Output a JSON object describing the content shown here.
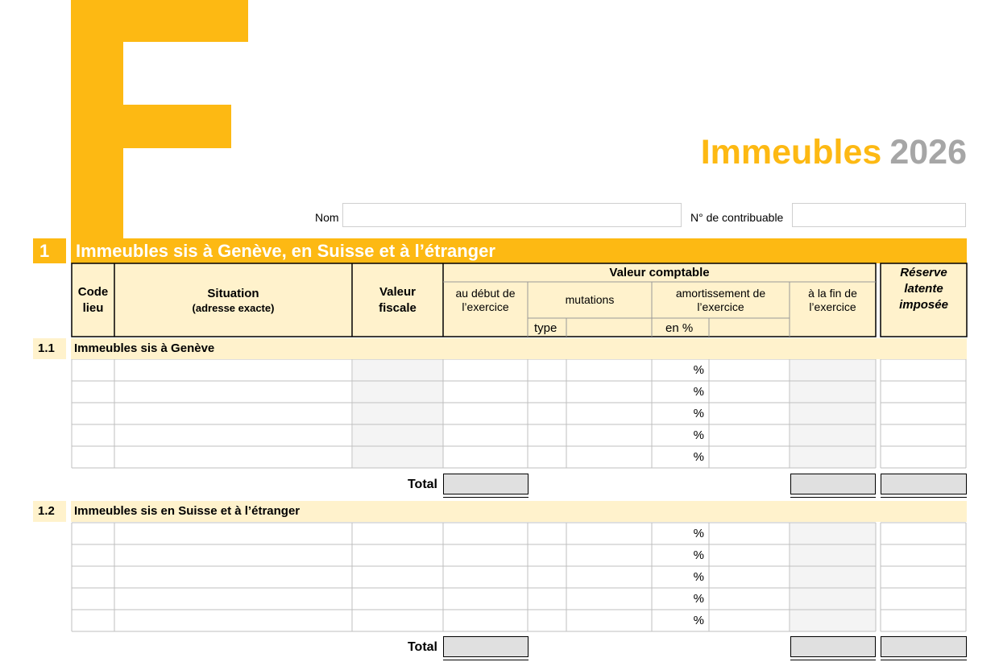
{
  "header": {
    "title_word": "Immeubles",
    "title_year": "2026",
    "nom_label": "Nom",
    "nom_value": "",
    "contribuable_label": "N° de contribuable",
    "contribuable_value": ""
  },
  "colors": {
    "brand": "#fdb913",
    "header_fill": "#fff2cc",
    "shaded": "#f2f2f2",
    "total_fill": "#e0e0e0"
  },
  "section1": {
    "number": "1",
    "title": "Immeubles sis à Genève, en Suisse et à l’étranger"
  },
  "table_header": {
    "code_lieu": "Code\nlieu",
    "code_lieu_1": "Code",
    "code_lieu_2": "lieu",
    "situation": "Situation",
    "situation_sub": "(adresse exacte)",
    "valeur_fiscale_1": "Valeur",
    "valeur_fiscale_2": "fiscale",
    "valeur_comptable": "Valeur comptable",
    "debut_1": "au début de",
    "debut_2": "l’exercice",
    "mutations": "mutations",
    "amortissement_1": "amortissement de",
    "amortissement_2": "l’exercice",
    "fin_1": "à la fin de",
    "fin_2": "l’exercice",
    "type": "type",
    "en_pct": "en %",
    "reserve_1": "Réserve",
    "reserve_2": "latente",
    "reserve_3": "imposée"
  },
  "subsection_1_1": {
    "number": "1.1",
    "title": "Immeubles sis à Genève",
    "rows": 5,
    "percent_symbol": "%",
    "total_label": "Total"
  },
  "subsection_1_2": {
    "number": "1.2",
    "title": "Immeubles sis en Suisse et à l’étranger",
    "rows": 5,
    "percent_symbol": "%",
    "total_label": "Total"
  }
}
